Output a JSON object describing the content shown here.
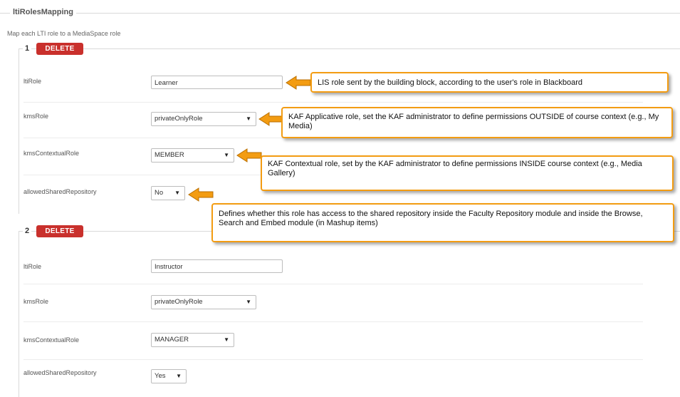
{
  "group": {
    "title": "ltiRolesMapping",
    "description": "Map each LTI role to a MediaSpace role"
  },
  "roles": [
    {
      "number": "1",
      "delete_label": "DELETE",
      "ltiRole_label": "ltiRole",
      "ltiRole_value": "Learner",
      "kmsRole_label": "kmsRole",
      "kmsRole_value": "privateOnlyRole",
      "kmsContextualRole_label": "kmsContextualRole",
      "kmsContextualRole_value": "MEMBER",
      "allowedSharedRepository_label": "allowedSharedRepository",
      "allowedSharedRepository_value": "No"
    },
    {
      "number": "2",
      "delete_label": "DELETE",
      "ltiRole_label": "ltiRole",
      "ltiRole_value": "Instructor",
      "kmsRole_label": "kmsRole",
      "kmsRole_value": "privateOnlyRole",
      "kmsContextualRole_label": "kmsContextualRole",
      "kmsContextualRole_value": "MANAGER",
      "allowedSharedRepository_label": "allowedSharedRepository",
      "allowedSharedRepository_value": "Yes"
    }
  ],
  "callouts": [
    {
      "text": "LIS role sent by the building block, according to the user's role in Blackboard"
    },
    {
      "text": "KAF Applicative role, set the KAF administrator to define permissions OUTSIDE of course context (e.g., My Media)"
    },
    {
      "text": "KAF Contextual role, set by the KAF administrator to define permissions INSIDE course context (e.g., Media Gallery)"
    },
    {
      "text": "Defines whether this role has access to the shared repository inside the Faculty Repository module and inside the Browse, Search and Embed module (in Mashup items)"
    }
  ],
  "icons": {
    "select_arrow": "caret-down-icon",
    "callout_arrow": "orange-arrow-icon"
  },
  "colors": {
    "delete_button": "#c9302c",
    "callout_border": "#f39c12"
  }
}
